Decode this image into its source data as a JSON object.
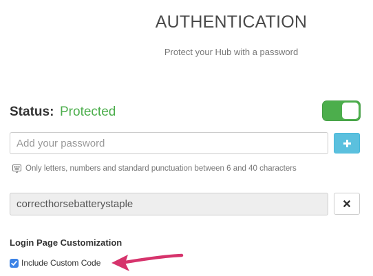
{
  "header": {
    "title": "AUTHENTICATION",
    "subtitle": "Protect your Hub with a password"
  },
  "status": {
    "label": "Status:",
    "value": "Protected",
    "value_color": "#4cae4c",
    "toggle_on": true
  },
  "password": {
    "placeholder": "Add your password",
    "add_icon": "plus-icon",
    "hint": "Only letters, numbers and standard punctuation between 6 and 40 characters",
    "hint_icon": "keyboard-icon",
    "current_value": "correcthorsebatterystaple",
    "remove_icon": "close-icon"
  },
  "customization": {
    "heading": "Login Page Customization",
    "checkbox_label": "Include Custom Code",
    "checkbox_checked": true
  },
  "annotation": {
    "arrow_color": "#d6336c"
  }
}
